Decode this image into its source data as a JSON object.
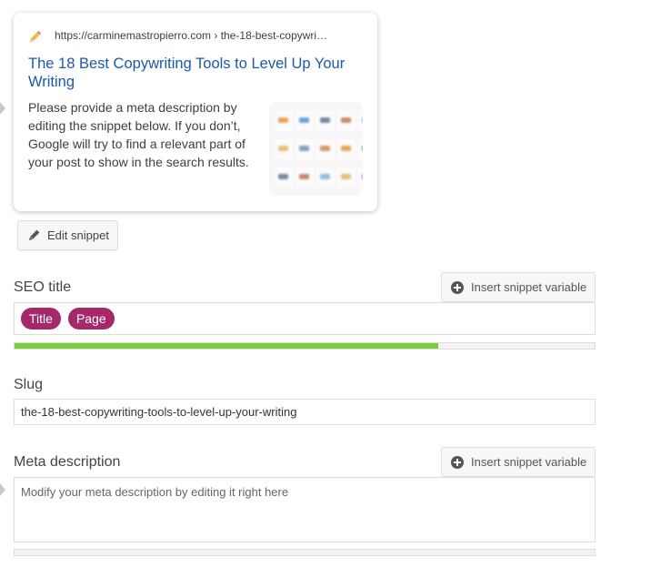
{
  "snippet_preview": {
    "url": "https://carminemastropierro.com › the-18-best-copywri…",
    "title": "The 18 Best Copywriting Tools to Level Up Your Writing",
    "description": "Please provide a meta description by editing the snippet below. If you don’t, Google will try to find a relevant part of your post to show in the search results.",
    "thumbnail_icon": "image-thumbnail"
  },
  "edit_snippet": {
    "label": "Edit snippet",
    "icon": "pencil-icon"
  },
  "seo_title": {
    "label": "SEO title",
    "insert_variable_label": "Insert snippet variable",
    "variables": [
      "Title",
      "Page"
    ],
    "progress_percent": 73,
    "progress_color": "#7ad03a",
    "pill_color": "#a4286a"
  },
  "slug": {
    "label": "Slug",
    "value": "the-18-best-copywriting-tools-to-level-up-your-writing"
  },
  "meta_description": {
    "label": "Meta description",
    "insert_variable_label": "Insert snippet variable",
    "placeholder": "Modify your meta description by editing it right here",
    "progress_percent": 0
  }
}
